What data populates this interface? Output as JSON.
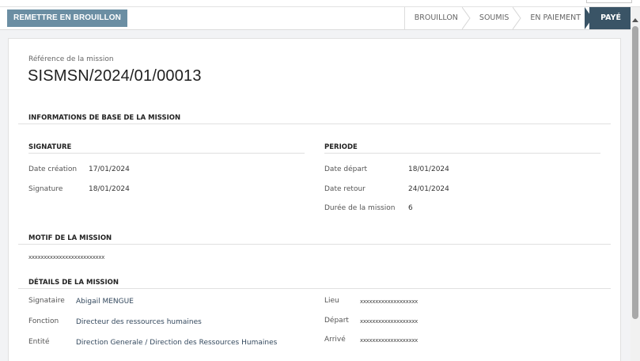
{
  "statusbar": {
    "draft_button": "REMETTRE EN BROUILLON",
    "stages": [
      "BROUILLON",
      "SOUMIS",
      "EN PAIEMENT",
      "PAYÉ"
    ],
    "active_stage": "PAYÉ"
  },
  "mission": {
    "ref_label": "Référence de la mission",
    "ref_value": "SISMSN/2024/01/00013"
  },
  "sections": {
    "base": "INFORMATIONS DE BASE DE LA MISSION",
    "signature": "SIGNATURE",
    "periode": "PERIODE",
    "motif": "MOTIF DE LA MISSION",
    "details": "DÉTAILS DE LA MISSION"
  },
  "signature": {
    "date_creation_label": "Date création",
    "date_creation": "17/01/2024",
    "signature_label": "Signature",
    "signature_date": "18/01/2024"
  },
  "periode": {
    "date_depart_label": "Date départ",
    "date_depart": "18/01/2024",
    "date_retour_label": "Date retour",
    "date_retour": "24/01/2024",
    "duree_label": "Durée de la mission",
    "duree": "6"
  },
  "motif": {
    "text": "xxxxxxxxxxxxxxxxxxxxxxxxx"
  },
  "details": {
    "signataire_label": "Signataire",
    "signataire": "Abigail MENGUE",
    "fonction_label": "Fonction",
    "fonction": "Directeur des ressources humaines",
    "entite_label": "Entité",
    "entite": "Direction Generale / Direction des Ressources Humaines",
    "lieu_label": "Lieu",
    "lieu": "xxxxxxxxxxxxxxxxxxx",
    "depart_label": "Départ",
    "depart": "xxxxxxxxxxxxxxxxxxx",
    "arrive_label": "Arrivé",
    "arrive": "xxxxxxxxxxxxxxxxxxx"
  },
  "colors": {
    "draft_button": "#6b8ea3",
    "active_stage": "#3a5466",
    "link": "#34495e"
  }
}
